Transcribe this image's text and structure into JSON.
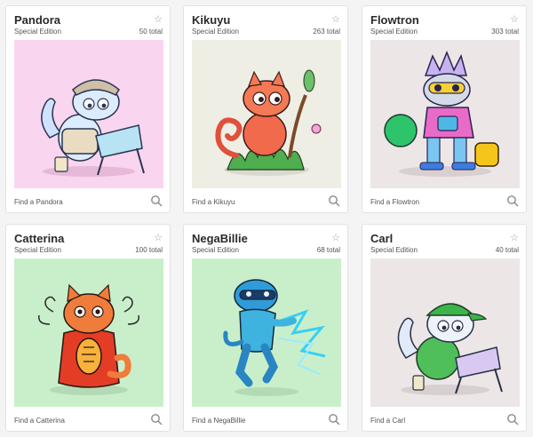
{
  "cards": [
    {
      "name": "Pandora",
      "edition": "Special Edition",
      "total": "50 total",
      "find": "Find a Pandora",
      "bg": "#f9d5ef",
      "icon": "cat-artist-icon"
    },
    {
      "name": "Kikuyu",
      "edition": "Special Edition",
      "total": "263 total",
      "find": "Find a Kikuyu",
      "bg": "#eeeee4",
      "icon": "chameleon-cat-icon"
    },
    {
      "name": "Flowtron",
      "edition": "Special Edition",
      "total": "303 total",
      "find": "Find a Flowtron",
      "bg": "#ece6e7",
      "icon": "robot-cat-icon"
    },
    {
      "name": "Catterina",
      "edition": "Special Edition",
      "total": "100 total",
      "find": "Find a Catterina",
      "bg": "#c9efca",
      "icon": "octopus-cat-icon"
    },
    {
      "name": "NegaBillie",
      "edition": "Special Edition",
      "total": "68 total",
      "find": "Find a NegaBillie",
      "bg": "#c9efca",
      "icon": "lightning-cat-icon"
    },
    {
      "name": "Carl",
      "edition": "Special Edition",
      "total": "40 total",
      "find": "Find a Carl",
      "bg": "#ece6e7",
      "icon": "cat-with-cap-icon"
    }
  ],
  "icons": {
    "favorite": "star-icon",
    "search": "magnifier-icon"
  }
}
